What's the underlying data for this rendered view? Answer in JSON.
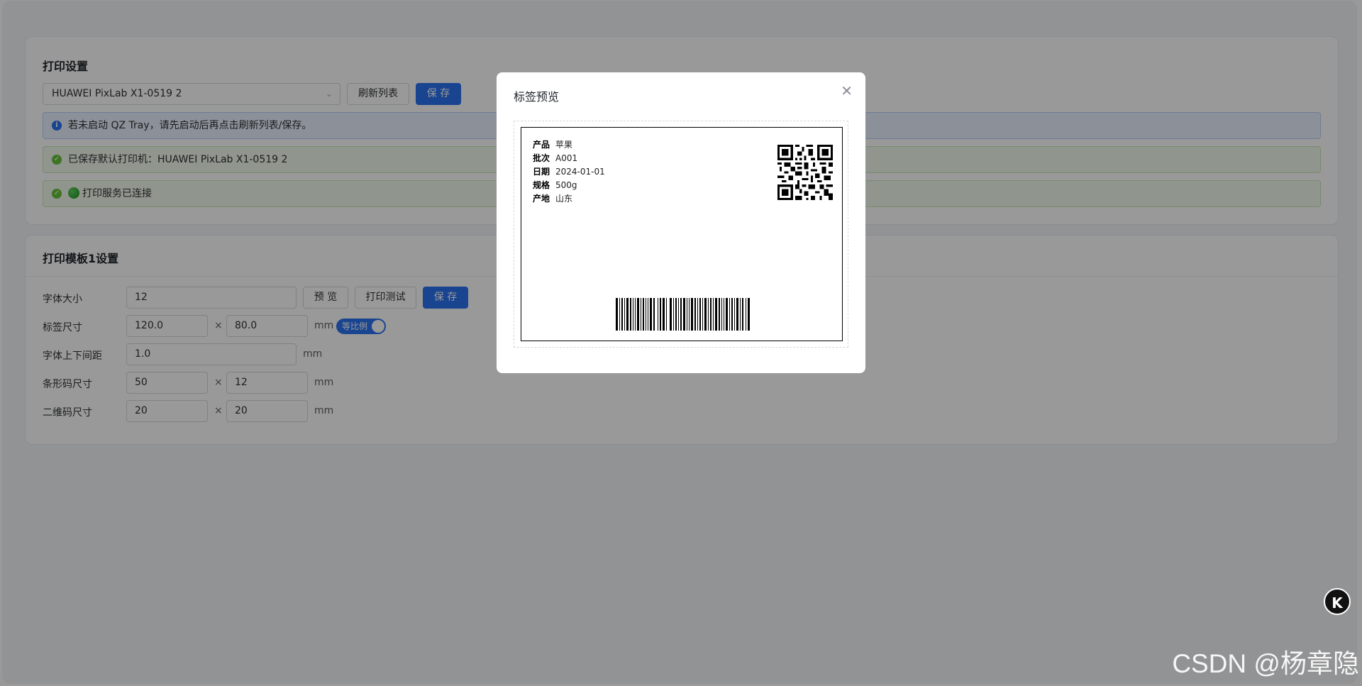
{
  "print_settings": {
    "title": "打印设置",
    "printer_selected": "HUAWEI PixLab X1-0519 2",
    "refresh_label": "刷新列表",
    "save_label": "保 存",
    "info_alert": "若未启动 QZ Tray，请先启动后再点击刷新列表/保存。",
    "saved_alert": "已保存默认打印机：HUAWEI PixLab X1-0519 2",
    "connected_alert": "打印服务已连接"
  },
  "template": {
    "title": "打印模板1设置",
    "font_size_label": "字体大小",
    "font_size_value": "12",
    "preview_label": "预 览",
    "print_test_label": "打印测试",
    "save_label": "保 存",
    "label_size_label": "标签尺寸",
    "label_width": "120.0",
    "label_height": "80.0",
    "times": "×",
    "unit": "mm",
    "ratio_toggle_label": "等比例",
    "ratio_toggle_on": true,
    "line_spacing_label": "字体上下间距",
    "line_spacing_value": "1.0",
    "barcode_size_label": "条形码尺寸",
    "barcode_width": "50",
    "barcode_height": "12",
    "qrcode_size_label": "二维码尺寸",
    "qrcode_width": "20",
    "qrcode_height": "20"
  },
  "dialog": {
    "title": "标签预览",
    "fields": [
      {
        "key": "产品",
        "value": "苹果"
      },
      {
        "key": "批次",
        "value": "A001"
      },
      {
        "key": "日期",
        "value": "2024-01-01"
      },
      {
        "key": "规格",
        "value": "500g"
      },
      {
        "key": "产地",
        "value": "山东"
      }
    ]
  },
  "floating_button": "K",
  "watermark": "CSDN @杨章隐",
  "colors": {
    "primary": "#2b72f0",
    "success": "#67c23a",
    "info_bg": "#eaf2ff",
    "success_bg": "#f0f9eb"
  },
  "icons": {
    "close": "close-icon",
    "chevron": "chevron-down-icon",
    "info": "info-circle-icon",
    "success": "check-circle-icon",
    "status_dot": "green-dot-icon"
  }
}
